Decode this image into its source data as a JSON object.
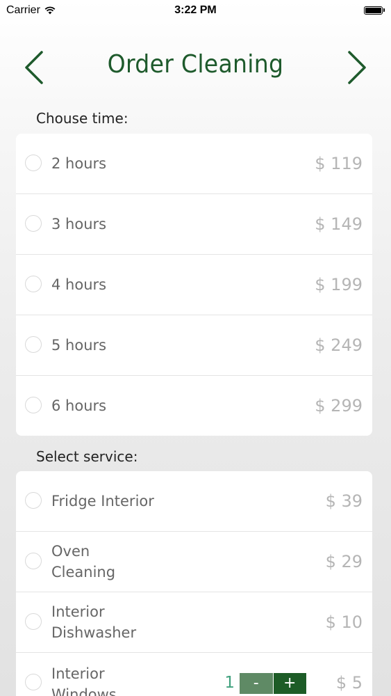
{
  "status_bar": {
    "carrier": "Carrier",
    "time": "3:22 PM",
    "battery_level": 1.0
  },
  "nav": {
    "title": "Order Cleaning",
    "back_icon": "chevron-left-icon",
    "forward_icon": "chevron-right-icon",
    "accent_color": "#1e5a2c"
  },
  "time_section": {
    "label": "Chouse time:",
    "options": [
      {
        "label": "2 hours",
        "price": "$ 119"
      },
      {
        "label": "3 hours",
        "price": "$ 149"
      },
      {
        "label": "4 hours",
        "price": "$ 199"
      },
      {
        "label": "5 hours",
        "price": "$ 249"
      },
      {
        "label": "6 hours",
        "price": "$ 299"
      }
    ]
  },
  "service_section": {
    "label": "Select service:",
    "options": [
      {
        "label": "Fridge Interior",
        "price": "$ 39"
      },
      {
        "label": "Oven Cleaning",
        "price": "$ 29"
      },
      {
        "label": "Interior Dishwasher",
        "price": "$ 10"
      },
      {
        "label": "Interior Windows",
        "price": "$ 5",
        "quantity": "1",
        "minus_label": "-",
        "plus_label": "+"
      }
    ]
  },
  "colors": {
    "stepper_minus": "#5f8a65",
    "stepper_plus": "#1d5c27",
    "quantity": "#41a17e"
  }
}
